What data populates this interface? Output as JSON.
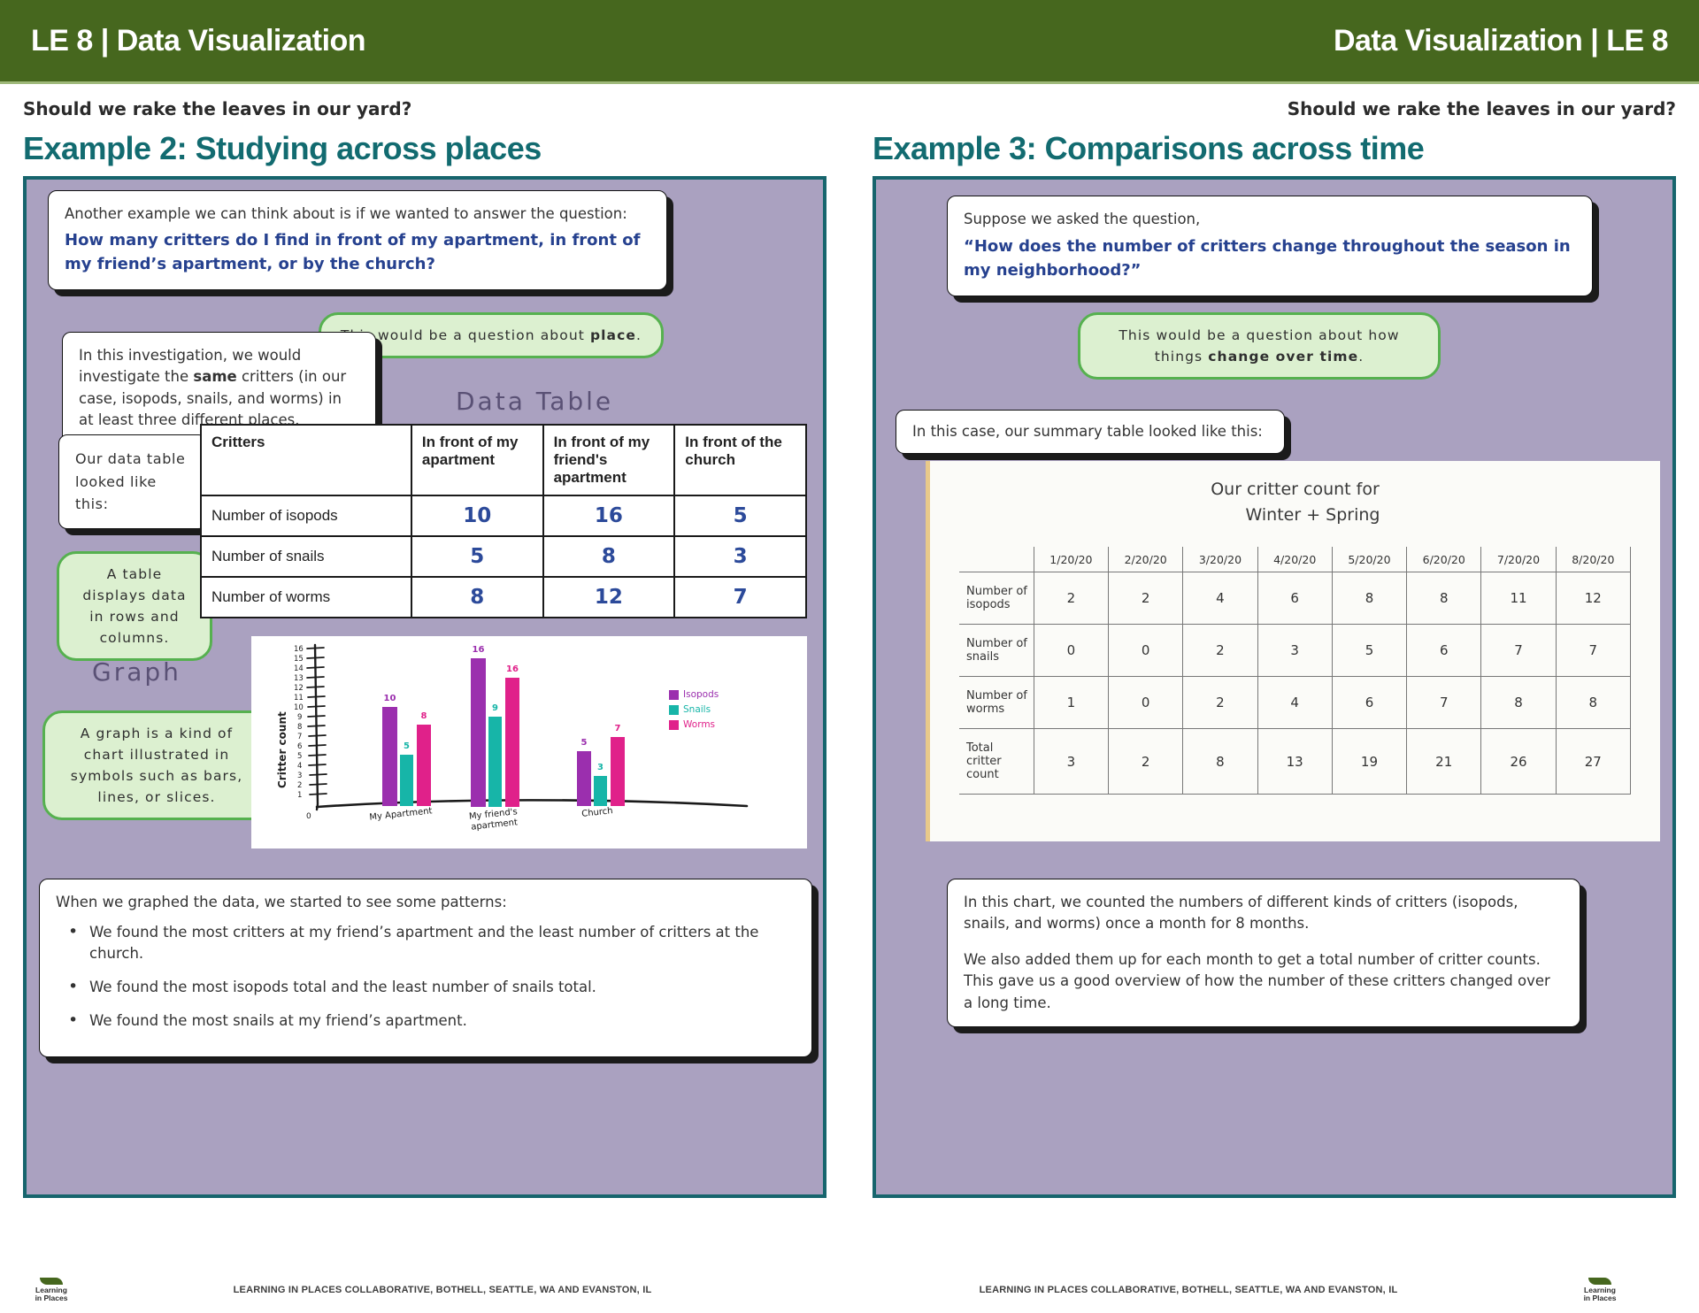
{
  "header": {
    "left_title": "LE 8 | Data Visualization",
    "right_title": "Data Visualization | LE 8",
    "bar_color": "#46671e"
  },
  "left": {
    "kicker": "Should we rake the leaves in our yard?",
    "section_title": "Example 2: Studying across places",
    "intro": {
      "line1": "Another example we can think about is if we wanted to answer the question:",
      "line2": "How many critters do I find in front of my apartment, in front of my friend’s apartment, or by the church?"
    },
    "callout_place": {
      "text_before": "This would be a question about ",
      "bold": "place",
      "text_after": "."
    },
    "investigation": {
      "part1": "In this investigation, we would investigate the ",
      "bold": "same",
      "part2": " critters (in our case, isopods, snails, and worms) in at least three different places."
    },
    "data_table_caption": "Our data table looked like this:",
    "data_table_label": "Data Table",
    "callout_table": "A table displays data in rows and columns.",
    "graph_label": "Graph",
    "callout_graph": "A graph is a kind of chart illustrated in symbols such as bars, lines, or slices.",
    "patterns": {
      "lead": "When we graphed the data, we started to see some patterns:",
      "items": [
        "We found the most critters at my friend’s apartment and the least number of critters at the church.",
        "We found the most isopods total and the least number of snails total.",
        "We found the most snails at my friend’s apartment."
      ]
    }
  },
  "right": {
    "kicker": "Should we rake the leaves in our yard?",
    "section_title": "Example 3: Comparisons across time",
    "suppose": {
      "line1": "Suppose we asked the question,",
      "line2": "“How does the number of critters change throughout the season in my neighborhood?”"
    },
    "callout_time": {
      "text_before": "This would be a question about how things ",
      "bold": "change over time",
      "text_after": "."
    },
    "summary_caption": "In this case, our summary table looked like this:",
    "photo_title_line1": "Our critter count for",
    "photo_title_line2": "Winter + Spring",
    "explain": {
      "p1": "In this chart, we counted the numbers of different kinds of critters (isopods, snails, and worms) once a month for 8 months.",
      "p2": "We also added them up for each month to get a total number of critter counts. This gave us a good overview of how the number of these critters changed over a long time."
    }
  },
  "footer": {
    "credit": "LEARNING IN PLACES COLLABORATIVE, BOTHELL, SEATTLE, WA AND EVANSTON, IL",
    "logo_line1": "Learning",
    "logo_line2": "in Places"
  },
  "chart_data": [
    {
      "type": "table",
      "title": "Data Table",
      "columns": [
        "Critters",
        "In front of  my apartment",
        "In front of my friend's apartment",
        "In front of the church"
      ],
      "rows": [
        {
          "label": "Number of isopods",
          "values": [
            "10",
            "16",
            "5"
          ]
        },
        {
          "label": "Number of snails",
          "values": [
            "5",
            "8",
            "3"
          ]
        },
        {
          "label": "Number of worms",
          "values": [
            "8",
            "12",
            "7"
          ]
        }
      ]
    },
    {
      "type": "bar",
      "title": "",
      "ylabel": "Critter count",
      "xlabel": "",
      "ylim": [
        0,
        17
      ],
      "grid": false,
      "legend_position": "right",
      "categories": [
        "My Apartment",
        "My friend's apartment",
        "Church"
      ],
      "series": [
        {
          "name": "Isopods",
          "color": "#9b2fae",
          "values": [
            10,
            16,
            5
          ]
        },
        {
          "name": "Snails",
          "color": "#17b5a8",
          "values": [
            5,
            9,
            3
          ]
        },
        {
          "name": "Worms",
          "color": "#e0218a",
          "values": [
            8,
            16,
            7
          ]
        }
      ]
    },
    {
      "type": "table",
      "title": "Our critter count for Winter + Spring",
      "columns": [
        "",
        "1/20/20",
        "2/20/20",
        "3/20/20",
        "4/20/20",
        "5/20/20",
        "6/20/20",
        "7/20/20",
        "8/20/20"
      ],
      "rows": [
        {
          "label": "Number of isopods",
          "values": [
            "2",
            "2",
            "4",
            "6",
            "8",
            "8",
            "11",
            "12"
          ],
          "colors": [
            "c-red",
            "c-teal",
            "c-green",
            "c-dark",
            "c-dark",
            "c-org",
            "c-green",
            "c-dark"
          ]
        },
        {
          "label": "Number of snails",
          "values": [
            "0",
            "0",
            "2",
            "3",
            "5",
            "6",
            "7",
            "7"
          ],
          "colors": [
            "c-red",
            "c-teal",
            "c-dark",
            "c-dark",
            "c-dark",
            "c-org",
            "c-green",
            "c-dark"
          ]
        },
        {
          "label": "Number of worms",
          "values": [
            "1",
            "0",
            "2",
            "4",
            "6",
            "7",
            "8",
            "8"
          ],
          "colors": [
            "c-red",
            "c-teal",
            "c-dark",
            "c-dark",
            "c-dark",
            "c-org",
            "c-green",
            "c-dark"
          ]
        },
        {
          "label": "Total critter count",
          "values": [
            "3",
            "2",
            "8",
            "13",
            "19",
            "21",
            "26",
            "27"
          ],
          "colors": [
            "c-red",
            "c-red",
            "c-org",
            "c-dark",
            "c-dark",
            "c-dark",
            "c-red",
            "c-red"
          ]
        }
      ]
    }
  ]
}
